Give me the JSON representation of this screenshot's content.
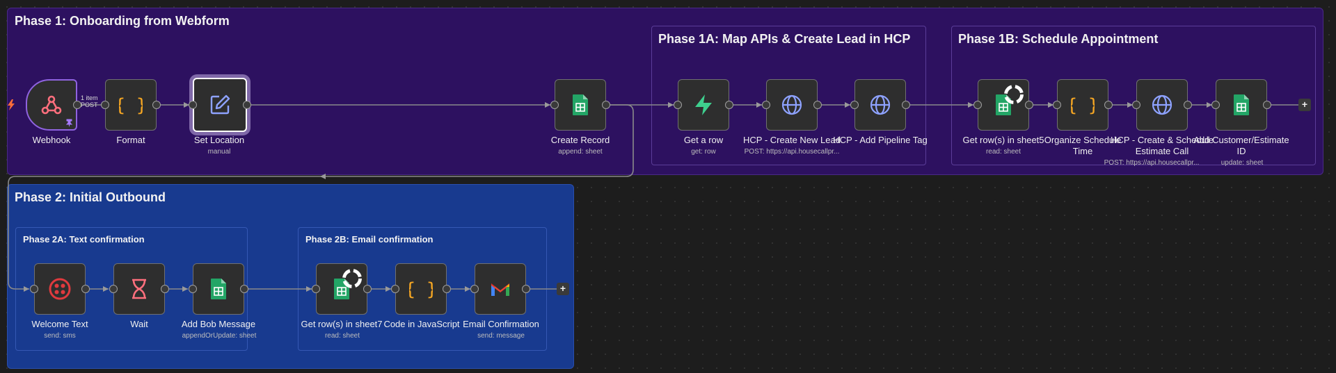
{
  "groups": {
    "phase1": "Phase 1: Onboarding from Webform",
    "phase1a": "Phase 1A: Map APIs & Create Lead in HCP",
    "phase1b": "Phase 1B: Schedule Appointment",
    "phase2": "Phase 2: Initial Outbound",
    "phase2a": "Phase 2A: Text confirmation",
    "phase2b": "Phase 2B: Email confirmation"
  },
  "nodes": {
    "webhook": {
      "label": "Webhook",
      "icon": "webhook-icon"
    },
    "format": {
      "label": "Format",
      "icon": "braces-icon"
    },
    "set_location": {
      "label": "Set Location",
      "sub": "manual",
      "icon": "pencil-icon"
    },
    "create_record": {
      "label": "Create Record",
      "sub": "append: sheet",
      "icon": "google-sheets-icon"
    },
    "get_a_row": {
      "label": "Get a row",
      "sub": "get: row",
      "icon": "supabase-icon"
    },
    "hcp_create_lead": {
      "label": "HCP - Create New Lead",
      "sub": "POST: https://api.housecallpr...",
      "icon": "globe-icon"
    },
    "hcp_pipeline_tag": {
      "label": "HCP - Add Pipeline Tag",
      "icon": "globe-icon"
    },
    "get_rows_sheet": {
      "label": "Get row(s) in sheet5",
      "sub": "read: sheet",
      "icon": "google-sheets-icon"
    },
    "organize_schedule": {
      "label1": "Organize Schedule",
      "label2": "Time",
      "icon": "braces-icon"
    },
    "hcp_create_schedule": {
      "label1": "HCP - Create & Schedule",
      "label2": "Estimate Call",
      "sub": "POST: https://api.housecallpr...",
      "icon": "globe-icon"
    },
    "add_customer_id": {
      "label1": "Add Customer/Estimate",
      "label2": "ID",
      "sub": "update: sheet",
      "icon": "google-sheets-icon"
    },
    "welcome_text": {
      "label": "Welcome Text",
      "sub": "send: sms",
      "icon": "twilio-icon"
    },
    "wait": {
      "label": "Wait",
      "icon": "hourglass-icon"
    },
    "add_bob_message": {
      "label": "Add Bob Message",
      "sub": "appendOrUpdate: sheet",
      "icon": "google-sheets-icon"
    },
    "get_rows_sheet7": {
      "label": "Get row(s) in sheet7",
      "sub": "read: sheet",
      "icon": "google-sheets-icon"
    },
    "code_js": {
      "label": "Code in JavaScript",
      "icon": "braces-icon"
    },
    "email_confirmation": {
      "label": "Email Confirmation",
      "sub": "send: message",
      "icon": "gmail-icon"
    }
  },
  "edge_badge": {
    "line1": "1 item",
    "line2": "POST"
  },
  "add_button": "+",
  "colors": {
    "phase1_bg": "#2d1160",
    "phase2_bg": "#183a8f",
    "canvas_bg": "#1d1d1d",
    "webhook_accent": "#8f63e0"
  }
}
